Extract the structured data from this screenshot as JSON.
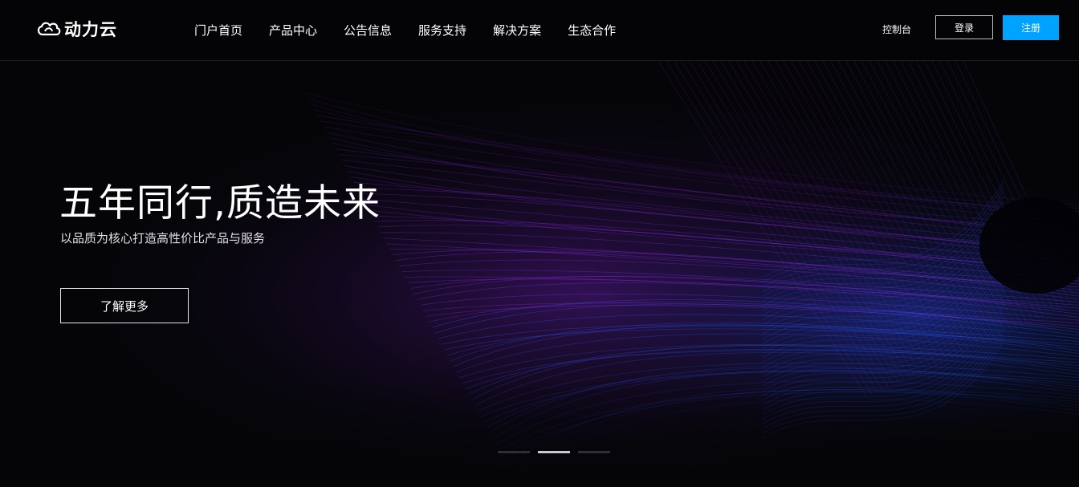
{
  "brand": {
    "name": "动力云",
    "icon": "cloud-logo-icon"
  },
  "nav": {
    "items": [
      {
        "label": "门户首页"
      },
      {
        "label": "产品中心"
      },
      {
        "label": "公告信息"
      },
      {
        "label": "服务支持"
      },
      {
        "label": "解决方案"
      },
      {
        "label": "生态合作"
      }
    ]
  },
  "header": {
    "console_label": "控制台",
    "login_label": "登录",
    "register_label": "注册"
  },
  "hero": {
    "title": "五年同行,质造未来",
    "subtitle": "以品质为核心打造高性价比产品与服务",
    "cta_label": "了解更多",
    "slides_total": 3,
    "active_slide": 2
  },
  "colors": {
    "accent": "#00a2ff",
    "background": "#050508",
    "wave_purple": "#8a2be2",
    "wave_blue": "#2b5cff"
  }
}
